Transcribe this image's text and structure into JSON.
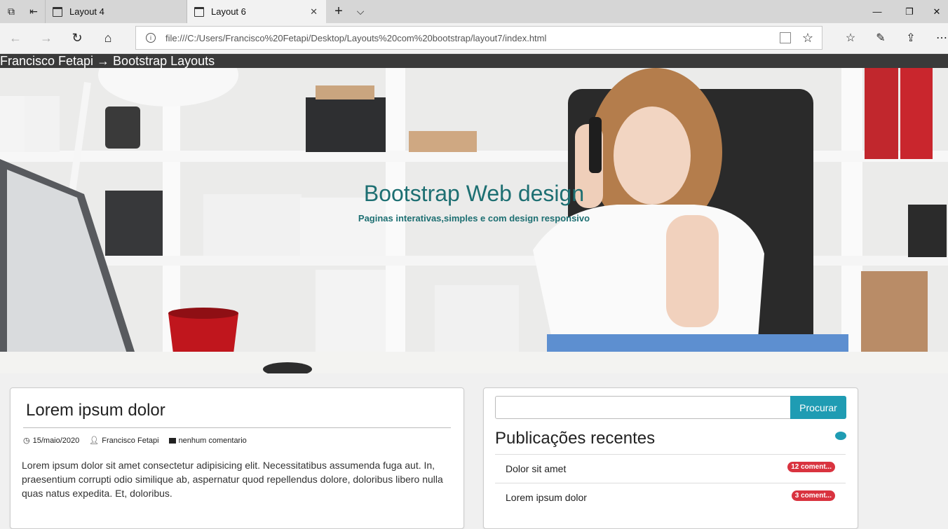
{
  "browser": {
    "tabs": [
      {
        "label": "Layout 4",
        "active": false
      },
      {
        "label": "Layout 6",
        "active": true
      }
    ],
    "url": "file:///C:/Users/Francisco%20Fetapi/Desktop/Layouts%20com%20bootstrap/layout7/index.html"
  },
  "site": {
    "nav_title": "Francisco Fetapi → Bootstrap Layouts",
    "hero_title": "Bootstrap Web design",
    "hero_subtitle": "Paginas interativas,simples e com design responsivo"
  },
  "post": {
    "title": "Lorem ipsum dolor",
    "date": "15/maio/2020",
    "author": "Francisco Fetapi",
    "comments": "nenhum comentario",
    "body": "Lorem ipsum dolor sit amet consectetur adipisicing elit. Necessitatibus assumenda fuga aut. In, praesentium corrupti odio similique ab, aspernatur quod repellendus dolore, doloribus libero nulla quas natus expedita. Et, doloribus."
  },
  "sidebar": {
    "search_button": "Procurar",
    "recent_title": "Publicações recentes",
    "recent": [
      {
        "label": "Dolor sit amet",
        "badge": "12 coment..."
      },
      {
        "label": "Lorem ipsum dolor",
        "badge": "3 coment..."
      }
    ]
  },
  "colors": {
    "accent": "#1f9cb3",
    "hero_text": "#1d6f72",
    "badge": "#d9333f"
  }
}
